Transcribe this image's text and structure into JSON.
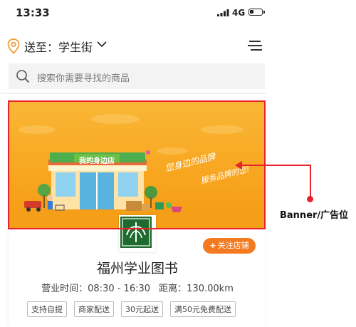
{
  "status_bar": {
    "time": "13:33",
    "network": "4G",
    "battery_level": 0.35
  },
  "location": {
    "label": "送至：学生街",
    "icon": "location-pin-icon"
  },
  "search": {
    "placeholder": "搜索你需要寻找的商品"
  },
  "banner": {
    "store_sign": "我的身边店",
    "slogan_line1": "您身边的品牌",
    "slogan_line2": "服务品牌的您!"
  },
  "shop": {
    "follow_label": "关注店铺",
    "name": "福州学业图书",
    "hours_label": "营业时间：08:30 - 16:30",
    "distance_label": "距离：130.00km",
    "tags": [
      "支持自提",
      "商家配送",
      "30元起送",
      "满50元免费配送"
    ]
  },
  "annotation": {
    "text": "Banner/广告位"
  },
  "colors": {
    "accent": "#f47a20",
    "banner": "#f8a51f",
    "highlight": "#e8232b",
    "store_green": "#4cae4c"
  }
}
